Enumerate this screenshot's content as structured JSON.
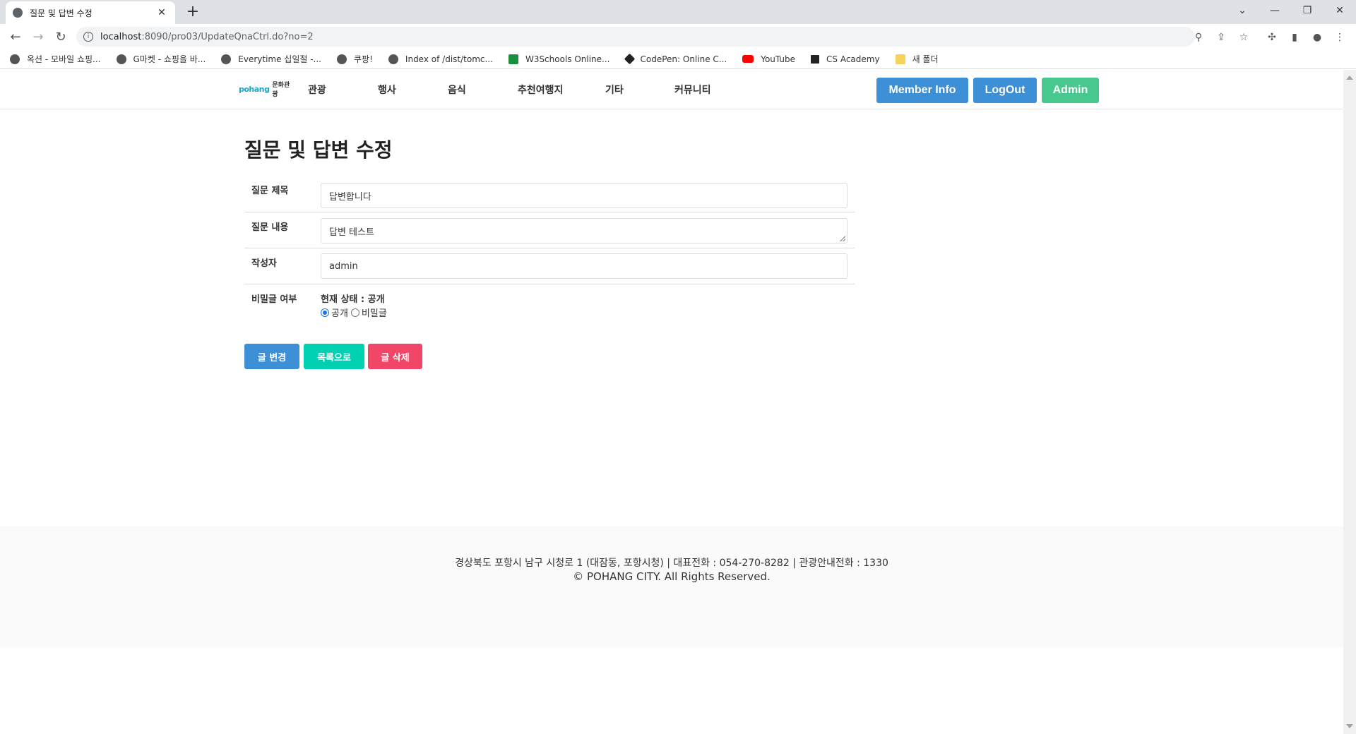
{
  "browser": {
    "tab_title": "질문 및 답변 수정",
    "url_host": "localhost",
    "url_path": ":8090/pro03/UpdateQnaCtrl.do?no=2",
    "bookmarks": [
      "옥션 - 모바일 쇼핑...",
      "G마켓 - 쇼핑을 바...",
      "Everytime 십일절 -...",
      "쿠팡!",
      "Index of /dist/tomc...",
      "W3Schools Online...",
      "CodePen: Online C...",
      "YouTube",
      "CS Academy",
      "새 폴더"
    ]
  },
  "header": {
    "logo_main": "pohang",
    "logo_sub": "문화관광",
    "menu": [
      "관광",
      "행사",
      "음식",
      "추천여행지",
      "기타",
      "커뮤니티"
    ],
    "member_info": "Member Info",
    "logout": "LogOut",
    "admin": "Admin"
  },
  "colors": {
    "blue": "#3d8fd6",
    "green": "#48c78e",
    "teal": "#00d1b2",
    "red": "#f14668"
  },
  "form": {
    "heading": "질문 및 답변 수정",
    "title_label": "질문 제목",
    "title_value": "답변합니다",
    "content_label": "질문 내용",
    "content_value": "답변 테스트",
    "author_label": "작성자",
    "author_value": "admin",
    "secret_label": "비밀글 여부",
    "status_text": "현재 상태 : 공개",
    "opt_public": "공개",
    "opt_secret": "비밀글",
    "btn_edit": "글 변경",
    "btn_list": "목록으로",
    "btn_delete": "글 삭제"
  },
  "footer": {
    "address": "경상북도 포항시 남구 시청로 1 (대잠동, 포항시청) | 대표전화 : 054-270-8282 | 관광안내전화 : 1330",
    "copyright": "© POHANG CITY. All Rights Reserved."
  }
}
